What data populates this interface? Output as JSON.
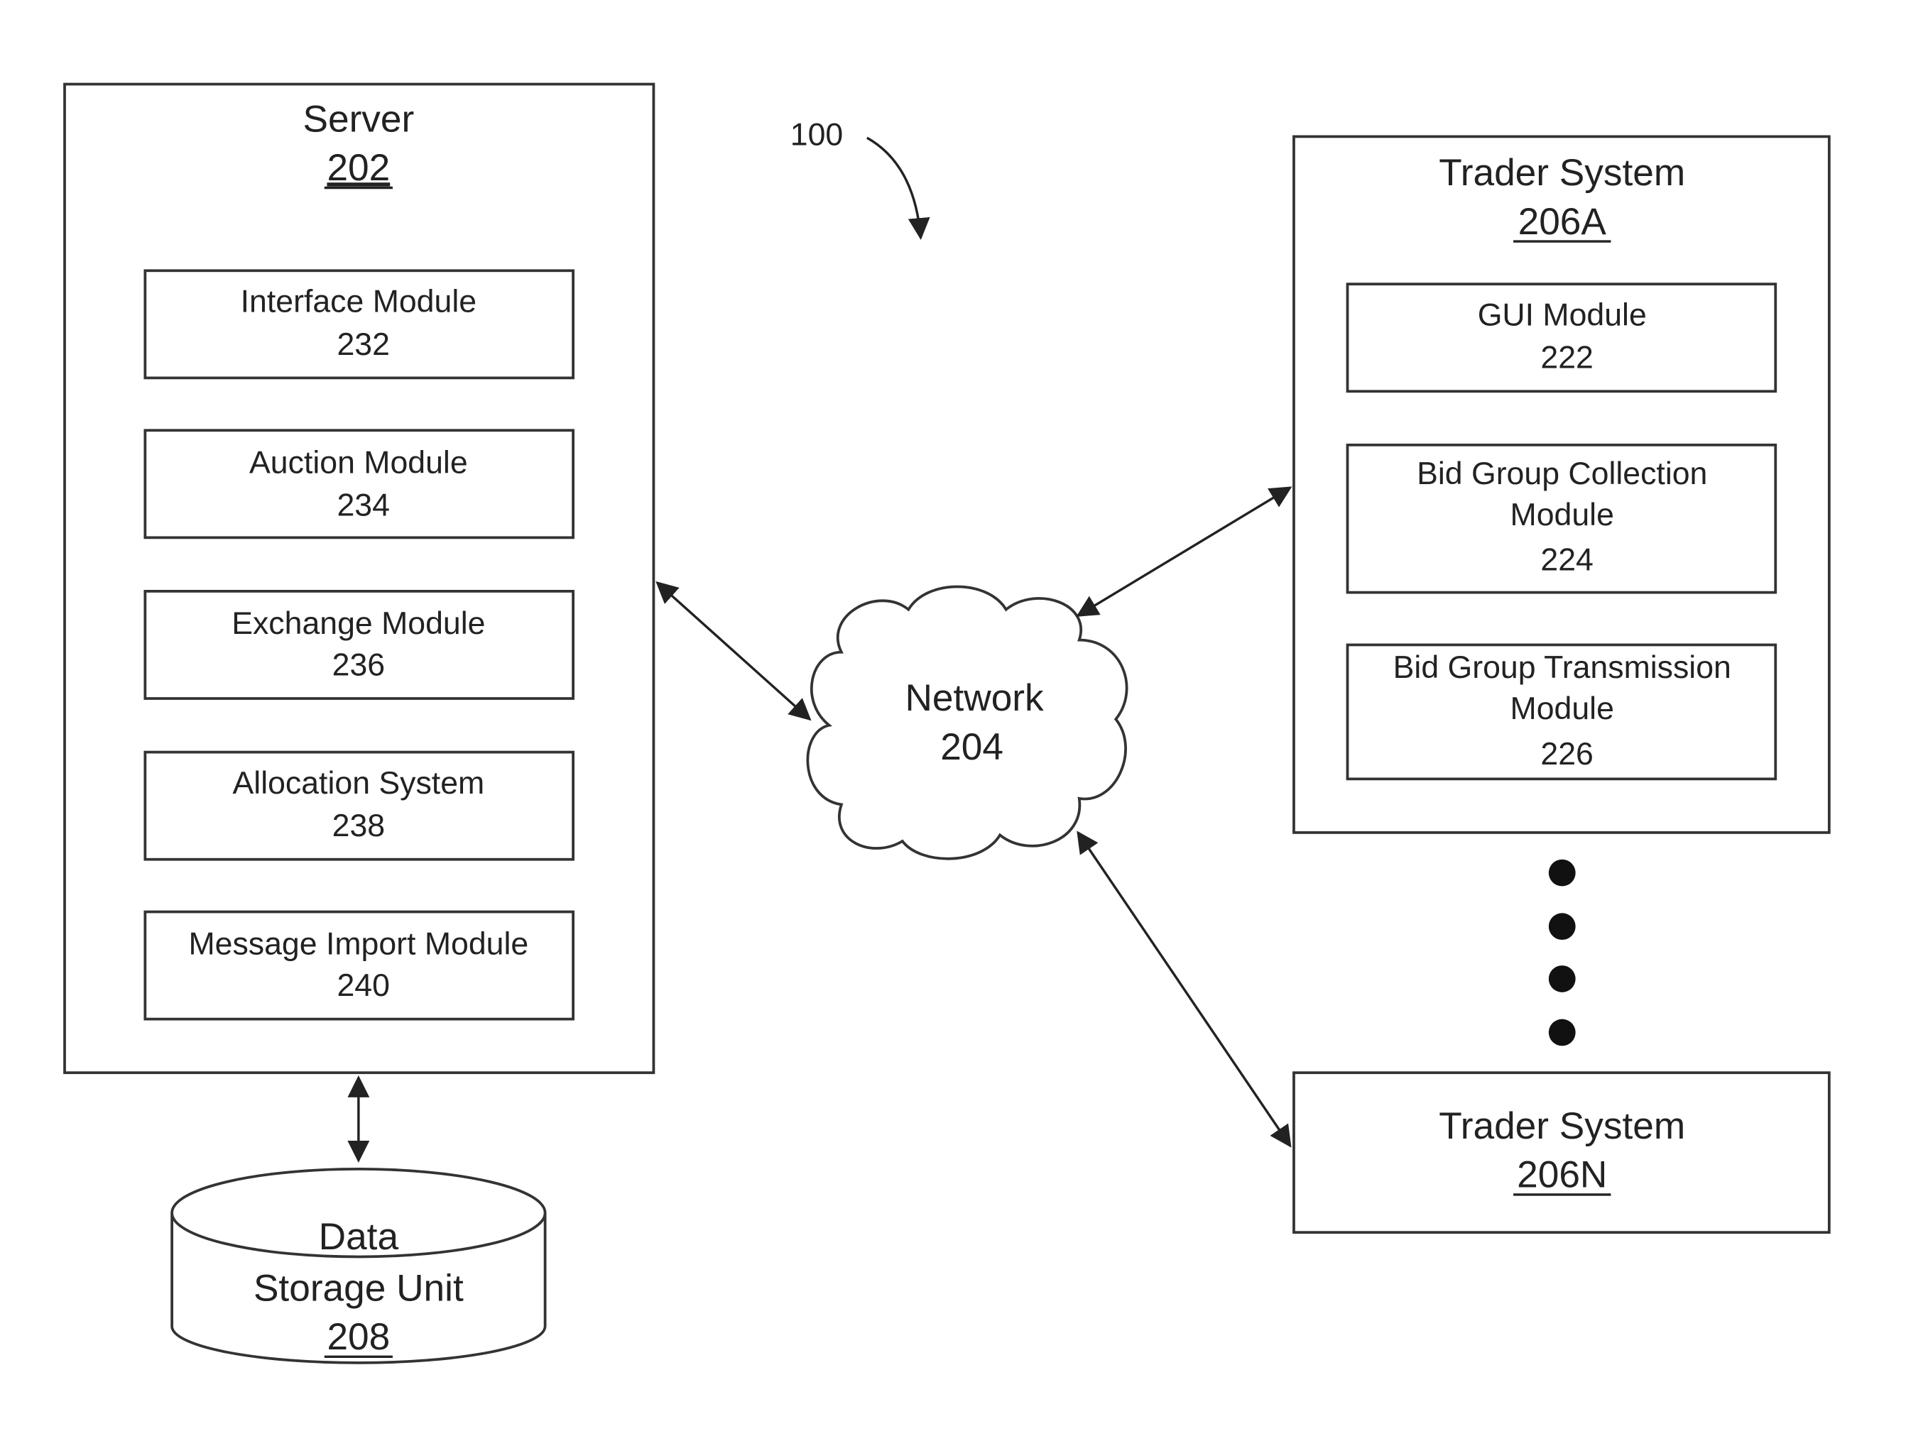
{
  "figure_ref": "100",
  "server": {
    "title": "Server",
    "ref": "202",
    "modules": [
      {
        "name": "Interface Module",
        "ref": "232"
      },
      {
        "name": "Auction Module",
        "ref": "234"
      },
      {
        "name": "Exchange Module",
        "ref": "236"
      },
      {
        "name": "Allocation System",
        "ref": "238"
      },
      {
        "name": "Message Import Module",
        "ref": "240"
      }
    ]
  },
  "network": {
    "title": "Network",
    "ref": "204"
  },
  "storage": {
    "line1": "Data",
    "line2": "Storage Unit",
    "ref": "208"
  },
  "trader_a": {
    "title": "Trader System",
    "ref": "206A",
    "modules": [
      {
        "line1": "GUI Module",
        "line2": "",
        "ref": "222"
      },
      {
        "line1": "Bid Group Collection",
        "line2": "Module",
        "ref": "224"
      },
      {
        "line1": "Bid Group Transmission",
        "line2": "Module",
        "ref": "226"
      }
    ]
  },
  "trader_n": {
    "title": "Trader System",
    "ref": "206N"
  }
}
